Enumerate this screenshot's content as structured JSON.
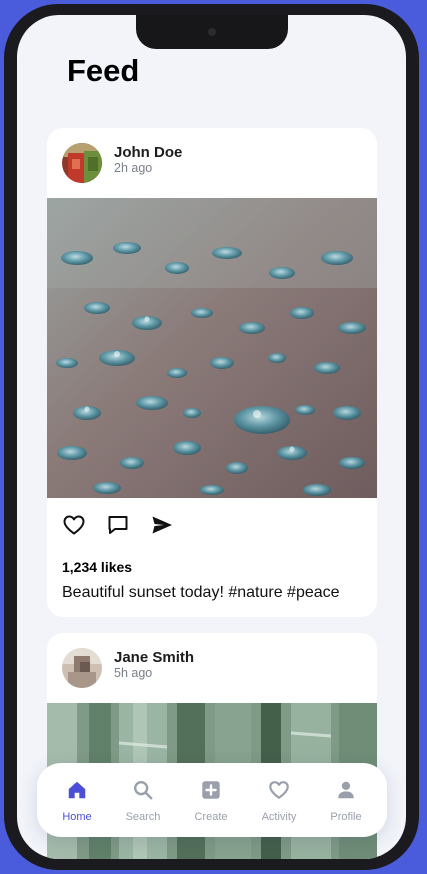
{
  "page": {
    "title": "Feed"
  },
  "posts": [
    {
      "user": "John Doe",
      "time": "2h ago",
      "avatar_icon": "avatar-photo",
      "image_subject": "water-droplets-photo",
      "likes": "1,234 likes",
      "caption": "Beautiful sunset today! #nature #peace"
    },
    {
      "user": "Jane Smith",
      "time": "5h ago",
      "avatar_icon": "avatar-photo",
      "image_subject": "bamboo-photo"
    }
  ],
  "actions": {
    "like_icon": "heart-icon",
    "comment_icon": "comment-icon",
    "share_icon": "send-icon"
  },
  "nav": {
    "items": [
      {
        "label": "Home",
        "icon": "home-icon",
        "active": true
      },
      {
        "label": "Search",
        "icon": "search-icon"
      },
      {
        "label": "Create",
        "icon": "plus-square-icon"
      },
      {
        "label": "Activity",
        "icon": "heart-icon"
      },
      {
        "label": "Profile",
        "icon": "person-icon"
      }
    ]
  },
  "colors": {
    "accent": "#4b4fd8",
    "background": "#f2f4fa",
    "frame": "#1b1b1f",
    "outer": "#4a5bdc"
  }
}
